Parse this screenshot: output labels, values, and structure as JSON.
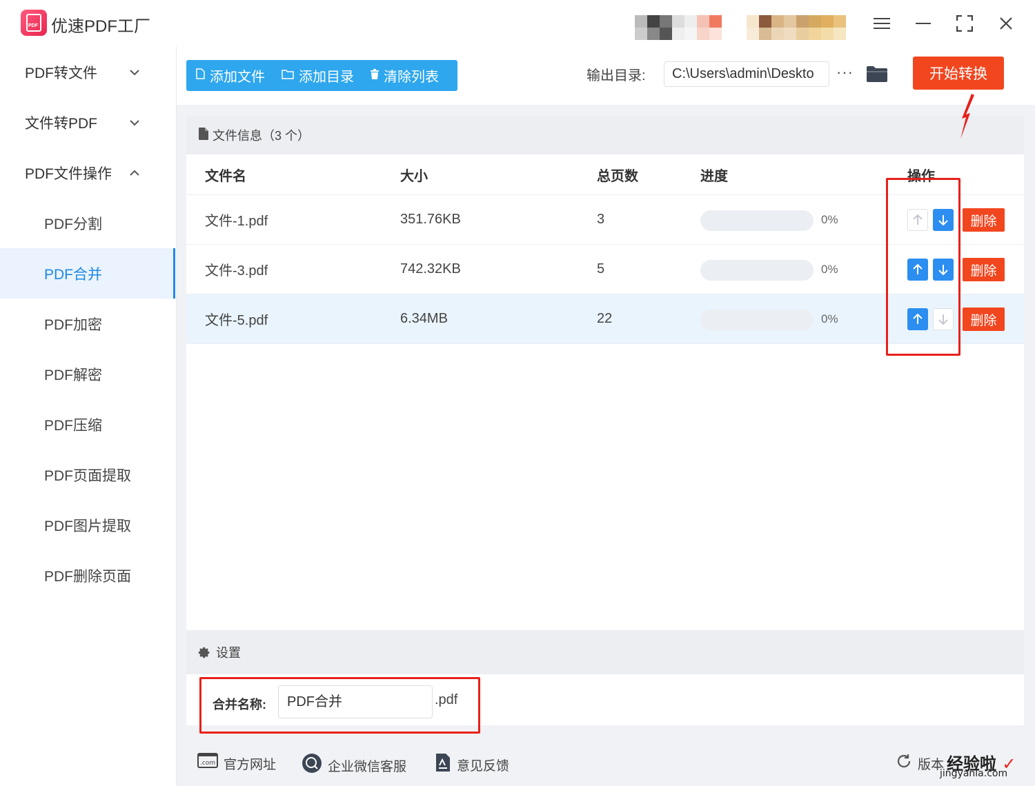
{
  "app": {
    "title": "优速PDF工厂",
    "logo_text": "PDF"
  },
  "sidebar": {
    "groups": [
      {
        "label": "PDF转文件",
        "chevron": "⌄"
      },
      {
        "label": "文件转PDF",
        "chevron": "⌄"
      },
      {
        "label": "PDF文件操作",
        "chevron": "^"
      }
    ],
    "items": [
      {
        "label": "PDF分割"
      },
      {
        "label": "PDF合并"
      },
      {
        "label": "PDF加密"
      },
      {
        "label": "PDF解密"
      },
      {
        "label": "PDF压缩"
      },
      {
        "label": "PDF页面提取"
      },
      {
        "label": "PDF图片提取"
      },
      {
        "label": "PDF删除页面"
      }
    ],
    "active": "PDF合并"
  },
  "toolbar": {
    "add_file": "添加文件",
    "add_dir": "添加目录",
    "clear_list": "清除列表",
    "output_label": "输出目录:",
    "output_path": "C:\\Users\\admin\\Deskto",
    "more": "···",
    "start": "开始转换"
  },
  "file_panel": {
    "title": "文件信息（3 个）",
    "columns": [
      "文件名",
      "大小",
      "总页数",
      "进度",
      "操作"
    ],
    "rows": [
      {
        "name": "文件-1.pdf",
        "size": "351.76KB",
        "pages": "3",
        "progress": "0%",
        "up_enabled": false,
        "down_enabled": true,
        "delete": "删除"
      },
      {
        "name": "文件-3.pdf",
        "size": "742.32KB",
        "pages": "5",
        "progress": "0%",
        "up_enabled": true,
        "down_enabled": true,
        "delete": "删除"
      },
      {
        "name": "文件-5.pdf",
        "size": "6.34MB",
        "pages": "22",
        "progress": "0%",
        "up_enabled": true,
        "down_enabled": false,
        "delete": "删除"
      }
    ]
  },
  "settings": {
    "title": "设置",
    "merge_label": "合并名称:",
    "merge_value": "PDF合并",
    "merge_ext": ".pdf"
  },
  "footer": {
    "website": "官方网址",
    "wechat": "企业微信客服",
    "feedback": "意见反馈",
    "version": "版本",
    "website_icon_text": ".com"
  },
  "watermark": {
    "text": "经验啦",
    "check": "✓",
    "url": "jingyanla.com"
  },
  "colors": {
    "accent_blue": "#2ea7ee",
    "button_blue": "#2b8ef0",
    "danger_red": "#f2461f",
    "annotation_red": "#e8201a"
  }
}
